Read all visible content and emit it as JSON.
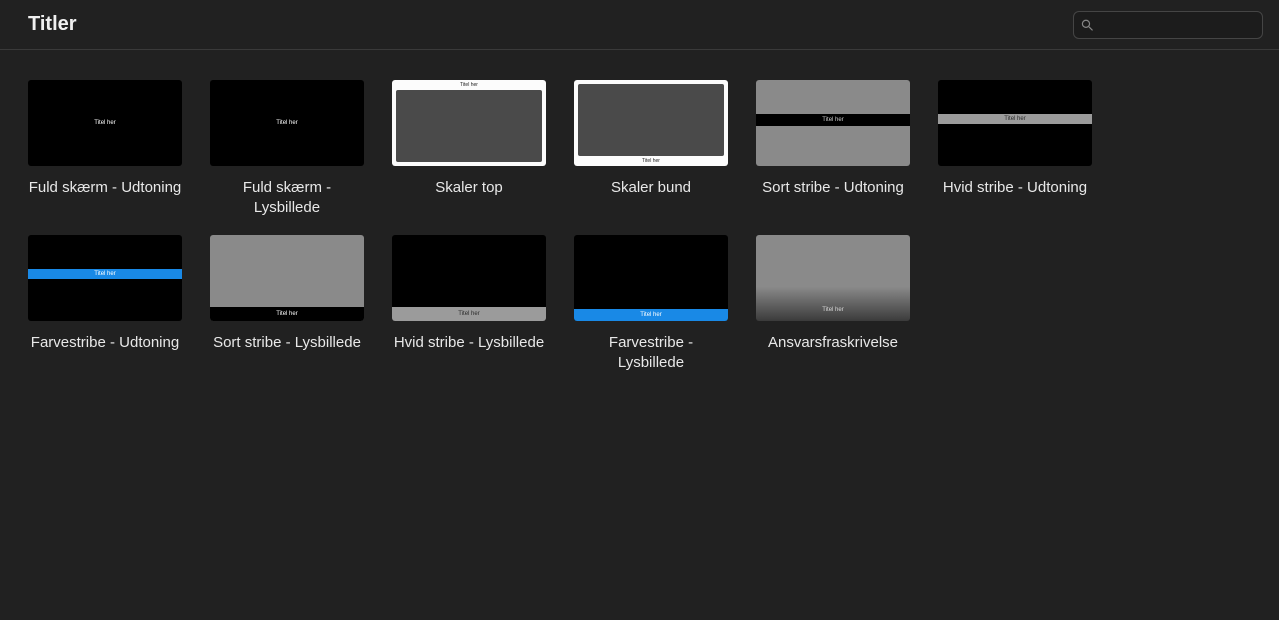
{
  "header": {
    "title": "Titler"
  },
  "search": {
    "placeholder": "",
    "value": ""
  },
  "thumbnail_text": "Titel her",
  "tiles": [
    {
      "label": "Fuld skærm - Udtoning"
    },
    {
      "label": "Fuld skærm - Lysbillede"
    },
    {
      "label": "Skaler top"
    },
    {
      "label": "Skaler bund"
    },
    {
      "label": "Sort stribe - Udtoning"
    },
    {
      "label": "Hvid stribe - Udtoning"
    },
    {
      "label": "Farvestribe - Udtoning"
    },
    {
      "label": "Sort stribe - Lysbillede"
    },
    {
      "label": "Hvid stribe - Lysbillede"
    },
    {
      "label": "Farvestribe - Lysbillede"
    },
    {
      "label": "Ansvarsfraskrivelse"
    }
  ]
}
